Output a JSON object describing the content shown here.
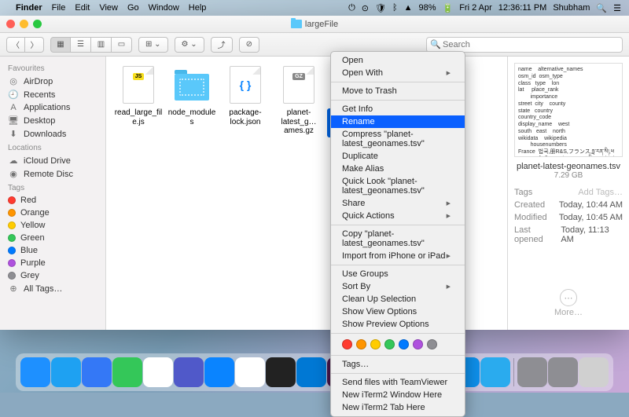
{
  "menubar": {
    "app": "Finder",
    "items": [
      "File",
      "Edit",
      "View",
      "Go",
      "Window",
      "Help"
    ],
    "status": {
      "battery": "98%",
      "day": "Fri 2 Apr",
      "time": "12:36:11 PM",
      "user": "Shubham"
    }
  },
  "window": {
    "title": "largeFile",
    "search_placeholder": "Search"
  },
  "sidebar": {
    "sections": [
      {
        "title": "Favourites",
        "items": [
          {
            "icon": "airdrop-icon",
            "glyph": "◎",
            "label": "AirDrop"
          },
          {
            "icon": "recents-icon",
            "glyph": "🕘",
            "label": "Recents"
          },
          {
            "icon": "applications-icon",
            "glyph": "A",
            "label": "Applications"
          },
          {
            "icon": "desktop-icon",
            "glyph": "🖥",
            "label": "Desktop"
          },
          {
            "icon": "downloads-icon",
            "glyph": "⬇",
            "label": "Downloads"
          }
        ]
      },
      {
        "title": "Locations",
        "items": [
          {
            "icon": "icloud-icon",
            "glyph": "☁",
            "label": "iCloud Drive"
          },
          {
            "icon": "remote-disc-icon",
            "glyph": "◉",
            "label": "Remote Disc"
          }
        ]
      },
      {
        "title": "Tags",
        "items": [
          {
            "icon": "tag-dot",
            "color": "#ff3b30",
            "label": "Red"
          },
          {
            "icon": "tag-dot",
            "color": "#ff9500",
            "label": "Orange"
          },
          {
            "icon": "tag-dot",
            "color": "#ffcc00",
            "label": "Yellow"
          },
          {
            "icon": "tag-dot",
            "color": "#34c759",
            "label": "Green"
          },
          {
            "icon": "tag-dot",
            "color": "#007aff",
            "label": "Blue"
          },
          {
            "icon": "tag-dot",
            "color": "#af52de",
            "label": "Purple"
          },
          {
            "icon": "tag-dot",
            "color": "#8e8e93",
            "label": "Grey"
          },
          {
            "icon": "all-tags-icon",
            "glyph": "⊕",
            "label": "All Tags…"
          }
        ]
      }
    ]
  },
  "files": [
    {
      "name": "read_large_file.js",
      "type": "js"
    },
    {
      "name": "node_modules",
      "type": "folder"
    },
    {
      "name": "package-lock.json",
      "type": "json"
    },
    {
      "name": "planet-latest_g…ames.gz",
      "type": "gz"
    },
    {
      "name": "planet-latest_geonames.tsv",
      "type": "tsv",
      "selected": true
    }
  ],
  "context_menu": {
    "groups": [
      [
        {
          "label": "Open"
        },
        {
          "label": "Open With",
          "submenu": true
        }
      ],
      [
        {
          "label": "Move to Trash"
        }
      ],
      [
        {
          "label": "Get Info"
        },
        {
          "label": "Rename",
          "highlighted": true
        },
        {
          "label": "Compress \"planet-latest_geonames.tsv\""
        },
        {
          "label": "Duplicate"
        },
        {
          "label": "Make Alias"
        },
        {
          "label": "Quick Look \"planet-latest_geonames.tsv\""
        },
        {
          "label": "Share",
          "submenu": true
        },
        {
          "label": "Quick Actions",
          "submenu": true
        }
      ],
      [
        {
          "label": "Copy \"planet-latest_geonames.tsv\""
        },
        {
          "label": "Import from iPhone or iPad",
          "submenu": true
        }
      ],
      [
        {
          "label": "Use Groups"
        },
        {
          "label": "Sort By",
          "submenu": true
        },
        {
          "label": "Clean Up Selection"
        },
        {
          "label": "Show View Options"
        },
        {
          "label": "Show Preview Options"
        }
      ],
      "tags",
      [
        {
          "label": "Tags…"
        }
      ],
      [
        {
          "label": "Send files with TeamViewer"
        },
        {
          "label": "New iTerm2 Window Here"
        },
        {
          "label": "New iTerm2 Tab Here"
        }
      ]
    ],
    "tag_colors": [
      "#ff3b30",
      "#ff9500",
      "#ffcc00",
      "#34c759",
      "#007aff",
      "#af52de",
      "#8e8e93"
    ]
  },
  "preview": {
    "thumb_text": "name    alternative_names\nosm_id  osm_type\nclass   type    lon\nlat     place_rank\n        importance\nstreet  city    county\nstate   country\ncountry_code\ndisplay_name    west\nsouth   east    north\nwikidata    wikipedia\n        housenumbers\nFrance  법국,册R&S,フランス,ཧྥ་རན་སི།,ཕརཱណཥ,ფრანგეთი,فرنسا,ཕའརསི,An Fhrainc,An Fhraing,Bro-C'hall,Bufalansa,Ֆիանսիա",
    "filename": "planet-latest-geonames.tsv",
    "size": "7.29 GB",
    "meta": [
      {
        "k": "Tags",
        "v": "Add Tags…"
      },
      {
        "k": "Created",
        "v": "Today, 10:44 AM"
      },
      {
        "k": "Modified",
        "v": "Today, 10:45 AM"
      },
      {
        "k": "Last opened",
        "v": "Today, 11:13 AM"
      }
    ],
    "more": "More…"
  },
  "dock": {
    "apps": [
      "finder",
      "safari",
      "mail",
      "maps",
      "photos",
      "teams",
      "appstore",
      "chrome",
      "terminal",
      "vscode",
      "slack",
      "chrome-canary",
      "word",
      "postman",
      "teamviewer",
      "telegram"
    ],
    "tray": [
      "launchpad",
      "downloads",
      "trash"
    ]
  }
}
